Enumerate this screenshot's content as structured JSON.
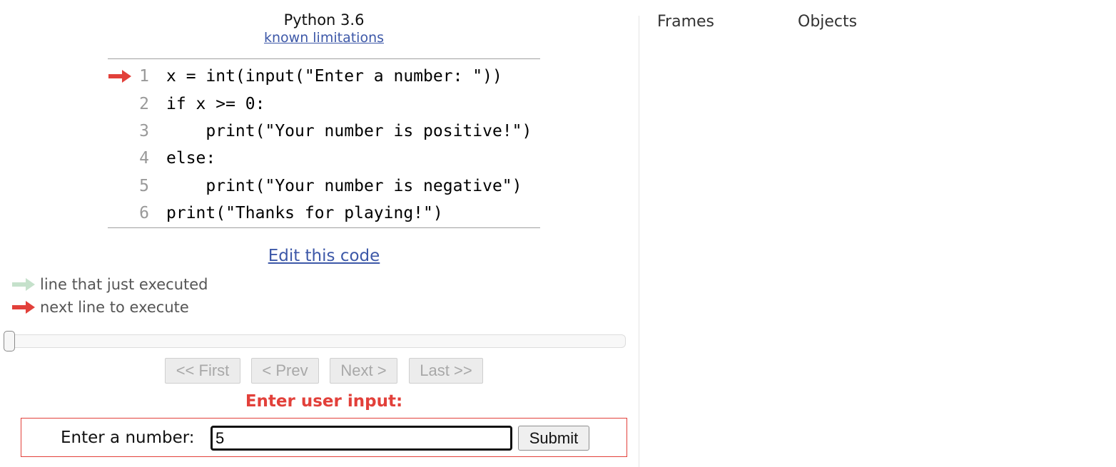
{
  "header": {
    "language": "Python 3.6",
    "limitations_link": "known limitations"
  },
  "code": {
    "lines": [
      {
        "number": "1",
        "text": "x = int(input(\"Enter a number: \"))"
      },
      {
        "number": "2",
        "text": "if x >= 0:"
      },
      {
        "number": "3",
        "text": "    print(\"Your number is positive!\")"
      },
      {
        "number": "4",
        "text": "else:"
      },
      {
        "number": "5",
        "text": "    print(\"Your number is negative\")"
      },
      {
        "number": "6",
        "text": "print(\"Thanks for playing!\")"
      }
    ],
    "next_line": 1
  },
  "edit_link": "Edit this code",
  "legend": {
    "executed_label": "line that just executed",
    "next_label": "next line to execute",
    "executed_color": "#c5e1cb",
    "next_color": "#e2403a"
  },
  "slider": {
    "position": 0
  },
  "navigation": {
    "first_label": "<< First",
    "prev_label": "< Prev",
    "next_label": "Next >",
    "last_label": "Last >>"
  },
  "user_input": {
    "heading": "Enter user input:",
    "prompt": "Enter a number:",
    "value": "5",
    "submit_label": "Submit"
  },
  "visualization": {
    "frames_header": "Frames",
    "objects_header": "Objects"
  },
  "colors": {
    "accent_red": "#e2403a",
    "link_blue": "#3d58a8"
  }
}
